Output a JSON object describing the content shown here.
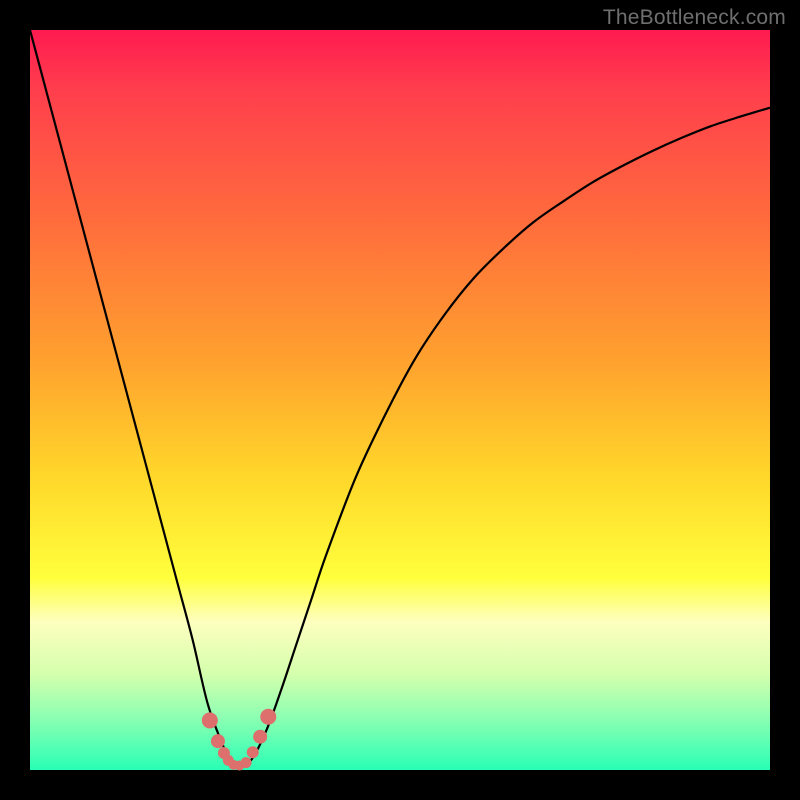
{
  "watermark": "TheBottleneck.com",
  "colors": {
    "frame_bg_top": "#ff1a50",
    "frame_bg_bottom": "#28ffb5",
    "page_bg": "#000000",
    "curve": "#000000",
    "marker_fill": "#dd6f6c",
    "marker_stroke": "#cc5a57"
  },
  "chart_data": {
    "type": "line",
    "title": "",
    "xlabel": "",
    "ylabel": "",
    "x": [
      0.0,
      0.02,
      0.04,
      0.06,
      0.08,
      0.1,
      0.12,
      0.14,
      0.16,
      0.18,
      0.2,
      0.22,
      0.24,
      0.26,
      0.272,
      0.285,
      0.3,
      0.32,
      0.34,
      0.36,
      0.38,
      0.4,
      0.44,
      0.48,
      0.52,
      0.56,
      0.6,
      0.64,
      0.68,
      0.72,
      0.76,
      0.8,
      0.84,
      0.88,
      0.92,
      0.96,
      1.0
    ],
    "y": [
      1.0,
      0.925,
      0.85,
      0.775,
      0.7,
      0.625,
      0.55,
      0.475,
      0.4,
      0.325,
      0.25,
      0.175,
      0.09,
      0.035,
      0.01,
      0.005,
      0.015,
      0.055,
      0.11,
      0.17,
      0.23,
      0.29,
      0.395,
      0.48,
      0.555,
      0.615,
      0.665,
      0.705,
      0.74,
      0.768,
      0.794,
      0.816,
      0.836,
      0.854,
      0.87,
      0.883,
      0.895
    ],
    "xlim": [
      0,
      1
    ],
    "ylim": [
      0,
      1
    ],
    "markers": {
      "x": [
        0.243,
        0.254,
        0.262,
        0.268,
        0.275,
        0.283,
        0.292,
        0.301,
        0.311,
        0.322
      ],
      "y": [
        0.067,
        0.039,
        0.023,
        0.013,
        0.007,
        0.006,
        0.01,
        0.024,
        0.045,
        0.072
      ],
      "r": [
        8,
        7,
        6,
        5.5,
        5,
        5,
        5.5,
        6,
        7,
        8
      ]
    }
  }
}
